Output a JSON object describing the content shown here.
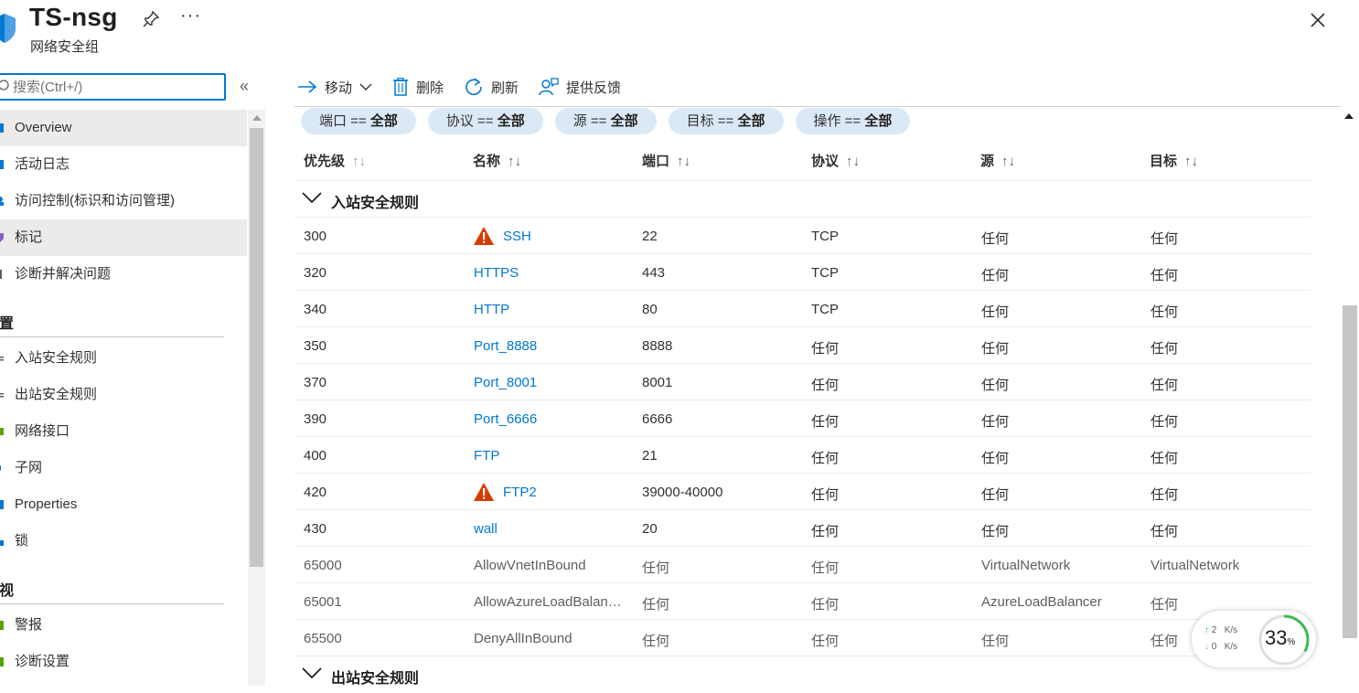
{
  "header": {
    "title": "TS-nsg",
    "subtitle": "网络安全组",
    "more_label": "···"
  },
  "sidebar": {
    "search_placeholder": "搜索(Ctrl+/)",
    "collapse_label": "«",
    "items_top": [
      {
        "label": "Overview",
        "active": true
      },
      {
        "label": "活动日志"
      },
      {
        "label": "访问控制(标识和访问管理)"
      },
      {
        "label": "标记",
        "active": true
      },
      {
        "label": "诊断并解决问题"
      }
    ],
    "section_settings": "置",
    "items_settings": [
      {
        "label": "入站安全规则"
      },
      {
        "label": "出站安全规则"
      },
      {
        "label": "网络接口"
      },
      {
        "label": "子网"
      },
      {
        "label": "Properties"
      },
      {
        "label": "锁"
      }
    ],
    "section_monitor": "视",
    "items_monitor": [
      {
        "label": "警报"
      },
      {
        "label": "诊断设置"
      }
    ]
  },
  "toolbar": {
    "move": "移动",
    "delete": "删除",
    "refresh": "刷新",
    "feedback": "提供反馈"
  },
  "filters": [
    {
      "key": "端口 == ",
      "value": "全部"
    },
    {
      "key": "协议 == ",
      "value": "全部"
    },
    {
      "key": "源 == ",
      "value": "全部"
    },
    {
      "key": "目标 == ",
      "value": "全部"
    },
    {
      "key": "操作 == ",
      "value": "全部"
    }
  ],
  "table": {
    "columns": [
      "优先级",
      "名称",
      "端口",
      "协议",
      "源",
      "目标"
    ],
    "sort_glyph": "↑↓",
    "inbound_group": "入站安全规则",
    "outbound_group": "出站安全规则",
    "rows": [
      [
        "300",
        "SSH",
        "22",
        "TCP",
        "任何",
        "任何"
      ],
      [
        "320",
        "HTTPS",
        "443",
        "TCP",
        "任何",
        "任何"
      ],
      [
        "340",
        "HTTP",
        "80",
        "TCP",
        "任何",
        "任何"
      ],
      [
        "350",
        "Port_8888",
        "8888",
        "任何",
        "任何",
        "任何"
      ],
      [
        "370",
        "Port_8001",
        "8001",
        "任何",
        "任何",
        "任何"
      ],
      [
        "390",
        "Port_6666",
        "6666",
        "任何",
        "任何",
        "任何"
      ],
      [
        "400",
        "FTP",
        "21",
        "任何",
        "任何",
        "任何"
      ],
      [
        "420",
        "FTP2",
        "39000-40000",
        "任何",
        "任何",
        "任何"
      ],
      [
        "430",
        "wall",
        "20",
        "任何",
        "任何",
        "任何"
      ],
      [
        "65000",
        "AllowVnetInBound",
        "任何",
        "任何",
        "VirtualNetwork",
        "VirtualNetwork"
      ],
      [
        "65001",
        "AllowAzureLoadBalan…",
        "任何",
        "任何",
        "AzureLoadBalancer",
        "任何"
      ],
      [
        "65500",
        "DenyAllInBound",
        "任何",
        "任何",
        "任何",
        "任何"
      ]
    ]
  },
  "netwidget": {
    "up": "2",
    "down": "0",
    "unit": "K/s",
    "percent": "33",
    "percent_sign": "%"
  },
  "colors": {
    "accent": "#0078d4",
    "pill_bg": "#dbe9f7",
    "warning": "#d83b01"
  }
}
